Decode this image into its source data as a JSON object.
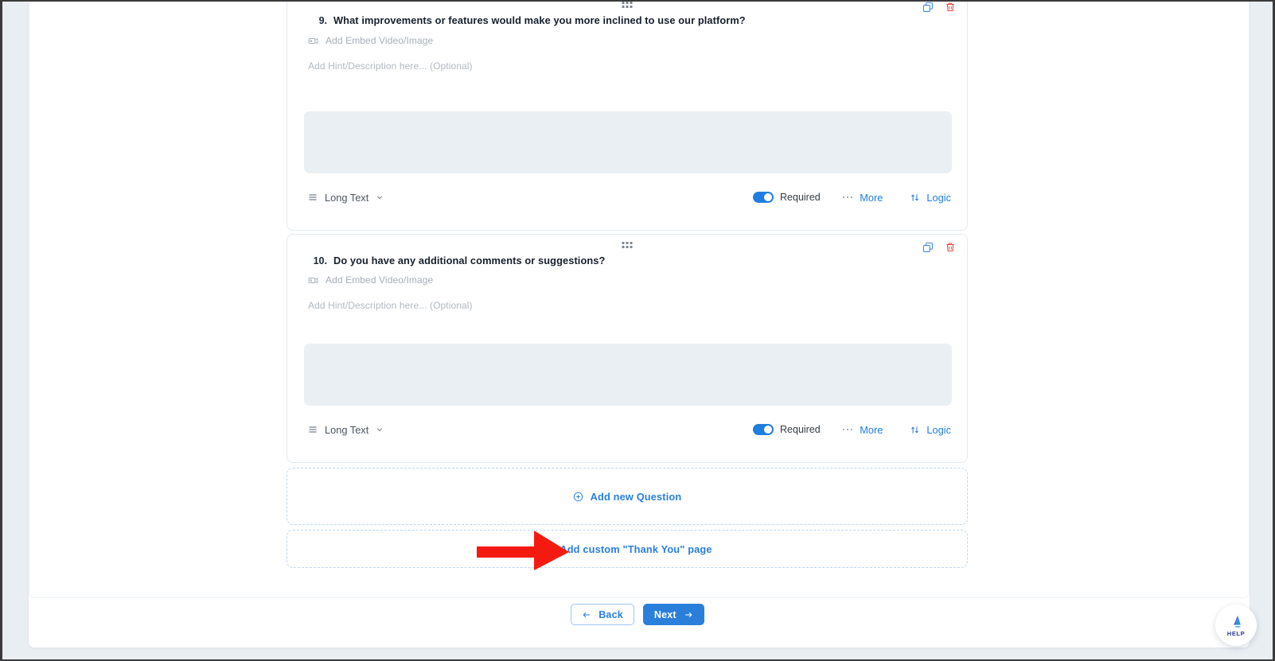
{
  "questions": [
    {
      "number": "9.",
      "text": "What improvements or features would make you more inclined to use our platform?",
      "embed_label": "Add Embed Video/Image",
      "hint_placeholder": "Add Hint/Description here... (Optional)",
      "answer_value": "",
      "type_label": "Long Text",
      "required_label": "Required",
      "required_on": true,
      "more_label": "More",
      "logic_label": "Logic",
      "duplicate_icon": "copy-icon",
      "delete_icon": "trash-icon",
      "drag_icon": "drag-handle-icon"
    },
    {
      "number": "10.",
      "text": "Do you have any additional comments or suggestions?",
      "embed_label": "Add Embed Video/Image",
      "hint_placeholder": "Add Hint/Description here... (Optional)",
      "answer_value": "",
      "type_label": "Long Text",
      "required_label": "Required",
      "required_on": true,
      "more_label": "More",
      "logic_label": "Logic",
      "duplicate_icon": "copy-icon",
      "delete_icon": "trash-icon",
      "drag_icon": "drag-handle-icon"
    }
  ],
  "add_zones": {
    "add_question_label": "Add new Question",
    "add_thankyou_label": "Add custom \"Thank You\" page",
    "plus_icon": "plus-circle-icon"
  },
  "footer": {
    "back_label": "Back",
    "next_label": "Next",
    "back_icon": "arrow-left-icon",
    "next_icon": "arrow-right-icon"
  },
  "help": {
    "label": "HELP",
    "icon": "megaphone-icon"
  },
  "annotation": {
    "arrow_icon": "red-arrow-right",
    "arrow_color": "#f51a10"
  },
  "colors": {
    "accent_blue": "#2a7fdb",
    "toggle_on": "#1f7fe0",
    "delete_red": "#e8483f",
    "answer_bg": "#eaeff4",
    "card_border": "#e3eaf1",
    "dashed_border": "#bcd8f2",
    "page_bg": "#e9eef3"
  }
}
